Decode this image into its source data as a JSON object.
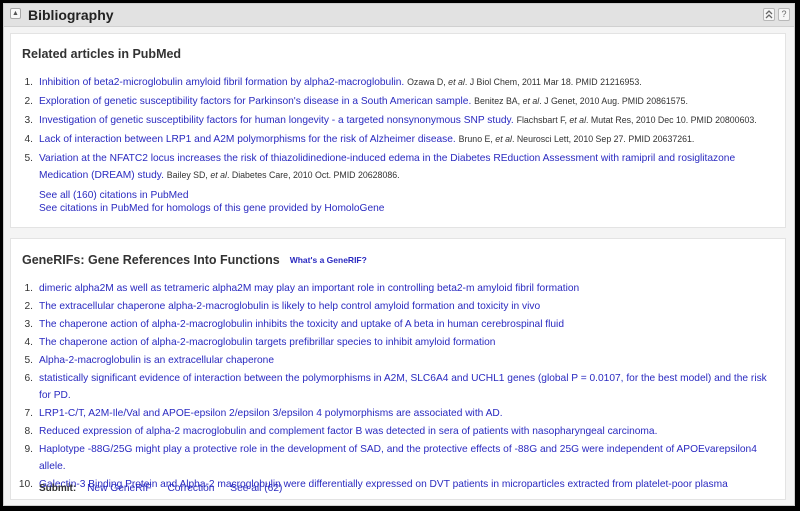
{
  "header": {
    "title": "Bibliography",
    "toggle_icon": "collapse-triangle-icon",
    "collapse_icon": "double-chevron-up-icon",
    "help_icon": "question-mark-icon",
    "toggle_glyph": "▲",
    "collapse_glyph": "≈",
    "help_glyph": "?"
  },
  "pubmed": {
    "heading": "Related articles in PubMed",
    "items": [
      {
        "num": "1.",
        "title": "Inhibition of beta2-microglobulin amyloid fibril formation by alpha2-macroglobulin.",
        "author": "Ozawa D,",
        "etal": "et al",
        "rest": ". J Biol Chem, 2011 Mar 18. PMID 21216953."
      },
      {
        "num": "2.",
        "title": "Exploration of genetic susceptibility factors for Parkinson's disease in a South American sample.",
        "author": "Benitez BA,",
        "etal": "et al",
        "rest": ". J Genet, 2010 Aug. PMID 20861575."
      },
      {
        "num": "3.",
        "title": "Investigation of genetic susceptibility factors for human longevity - a targeted nonsynonymous SNP study.",
        "author": "Flachsbart F,",
        "etal": "et al",
        "rest": ". Mutat Res, 2010 Dec 10. PMID 20800603."
      },
      {
        "num": "4.",
        "title": "Lack of interaction between LRP1 and A2M polymorphisms for the risk of Alzheimer disease.",
        "author": "Bruno E,",
        "etal": "et al",
        "rest": ". Neurosci Lett, 2010 Sep 27. PMID 20637261."
      },
      {
        "num": "5.",
        "title": "Variation at the NFATC2 locus increases the risk of thiazolidinedione-induced edema in the Diabetes REduction Assessment with ramipril and rosiglitazone Medication (DREAM) study.",
        "author": "Bailey SD,",
        "etal": "et al",
        "rest": ". Diabetes Care, 2010 Oct. PMID 20628086."
      }
    ],
    "see_all": "See all (160) citations in PubMed",
    "homologs": "See citations in PubMed for homologs of this gene provided by HomoloGene"
  },
  "generifs": {
    "heading": "GeneRIFs: Gene References Into Functions",
    "whats_link": "What's a GeneRIF?",
    "items": [
      {
        "num": "1.",
        "text": "dimeric alpha2M as well as tetrameric alpha2M may play an important role in controlling beta2-m amyloid fibril formation"
      },
      {
        "num": "2.",
        "text": "The extracellular chaperone alpha-2-macroglobulin is likely to help control amyloid formation and toxicity in vivo"
      },
      {
        "num": "3.",
        "text": "The chaperone action of alpha-2-macroglobulin inhibits the toxicity and uptake of A beta in human cerebrospinal fluid"
      },
      {
        "num": "4.",
        "text": "The chaperone action of alpha-2-macroglobulin targets prefibrillar species to inhibit amyloid formation"
      },
      {
        "num": "5.",
        "text": "Alpha-2-macroglobulin is an extracellular chaperone"
      },
      {
        "num": "6.",
        "text": "statistically significant evidence of interaction between the polymorphisms in A2M, SLC6A4 and UCHL1 genes (global P = 0.0107, for the best model) and the risk for PD."
      },
      {
        "num": "7.",
        "text": "LRP1-C/T, A2M-Ile/Val and APOE-epsilon 2/epsilon 3/epsilon 4 polymorphisms are associated with AD."
      },
      {
        "num": "8.",
        "text": "Reduced expression of alpha-2 macroglobulin and complement factor B was detected in sera of patients with nasopharyngeal carcinoma."
      },
      {
        "num": "9.",
        "text": "Haplotype -88G/25G might play a protective role in the development of SAD, and the protective effects of -88G and 25G were independent of APOEvarepsilon4 allele."
      },
      {
        "num": "10.",
        "text": "Galectin-3 Binding Protein and Alpha-2 macroglobulin were differentially expressed on DVT patients in microparticles extracted from platelet-poor plasma"
      }
    ],
    "submit_label": "Submit:",
    "new_generif": "New GeneRIF",
    "correction": "Correction",
    "see_all": "See all (62)"
  }
}
